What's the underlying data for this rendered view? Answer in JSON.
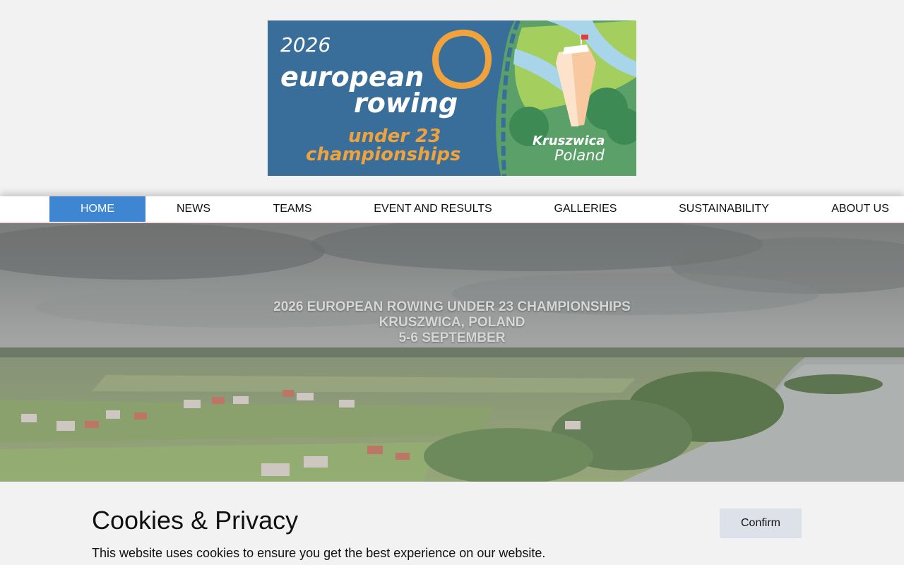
{
  "logo": {
    "year": "2026",
    "line1": "european",
    "line2": "rowing",
    "line3": "under 23",
    "line4": "championships",
    "city": "Kruszwica",
    "country": "Poland"
  },
  "nav": {
    "items": [
      {
        "label": "HOME",
        "active": true
      },
      {
        "label": "NEWS"
      },
      {
        "label": "TEAMS"
      },
      {
        "label": "EVENT AND RESULTS"
      },
      {
        "label": "GALLERIES"
      },
      {
        "label": "SUSTAINABILITY"
      },
      {
        "label": "ABOUT US"
      }
    ]
  },
  "hero": {
    "line1": "2026 EUROPEAN ROWING UNDER 23 CHAMPIONSHIPS",
    "line2": "KRUSZWICA, POLAND",
    "line3": "5-6 SEPTEMBER"
  },
  "cookie": {
    "title": "Cookies & Privacy",
    "text": "This website uses cookies to ensure you get the best experience on our website.",
    "confirm_label": "Confirm"
  },
  "colors": {
    "nav_active": "#3e86d2",
    "logo_blue": "#3a6e9a",
    "logo_orange": "#f0a23c",
    "logo_green": "#6aa860"
  }
}
